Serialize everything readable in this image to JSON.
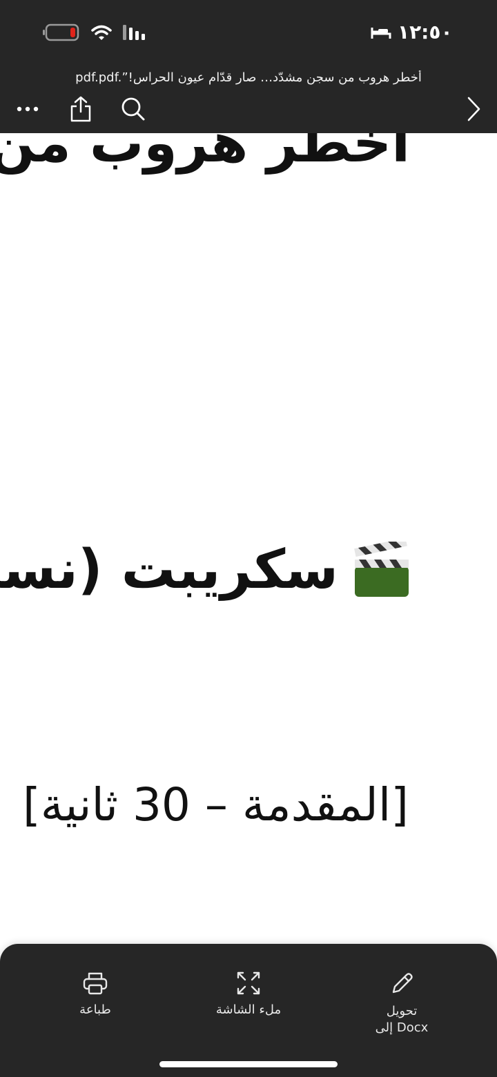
{
  "status_bar": {
    "time": "١٢:٥٠"
  },
  "header": {
    "document_title": "pdf.pdf.”!أخطر هروب من سجن مشدّد… صار قدّام عيون الحراس",
    "more_icon": "more-horizontal-icon",
    "share_icon": "share-icon",
    "search_icon": "search-icon",
    "forward_icon": "chevron-right-icon"
  },
  "document": {
    "heading_1": "أخطر هروب من سجن",
    "heading_2": "سكريبت (نسخة",
    "heading_2_emoji": "clapperboard-icon",
    "section_label": "[المقدمة – 30 ثانية]"
  },
  "bottom_sheet": {
    "actions": [
      {
        "label": "تحويل\nإلى Docx",
        "icon": "pencil-icon"
      },
      {
        "label": "ملء الشاشة",
        "icon": "expand-icon"
      },
      {
        "label": "طباعة",
        "icon": "printer-icon"
      }
    ]
  },
  "colors": {
    "bar_background": "#262626",
    "page_background": "#ffffff",
    "text": "#111111",
    "battery_low": "#e0241b",
    "clapper_green": "#3b6b22"
  }
}
